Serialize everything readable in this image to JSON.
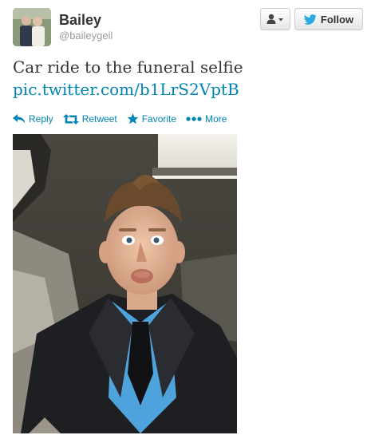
{
  "user": {
    "display_name": "Bailey",
    "handle": "@baileygeil"
  },
  "buttons": {
    "follow_label": "Follow"
  },
  "tweet": {
    "text": "Car ride to the funeral selfie",
    "link": "pic.twitter.com/b1LrS2VptB"
  },
  "actions": {
    "reply": "Reply",
    "retweet": "Retweet",
    "favorite": "Favorite",
    "more": "More"
  },
  "colors": {
    "link": "#0084b4",
    "twitter_blue": "#2aa9e0",
    "handle_gray": "#999999"
  },
  "icons": [
    "user-icon",
    "caret-down-icon",
    "twitter-bird-icon",
    "reply-icon",
    "retweet-icon",
    "star-icon",
    "more-dots-icon"
  ]
}
